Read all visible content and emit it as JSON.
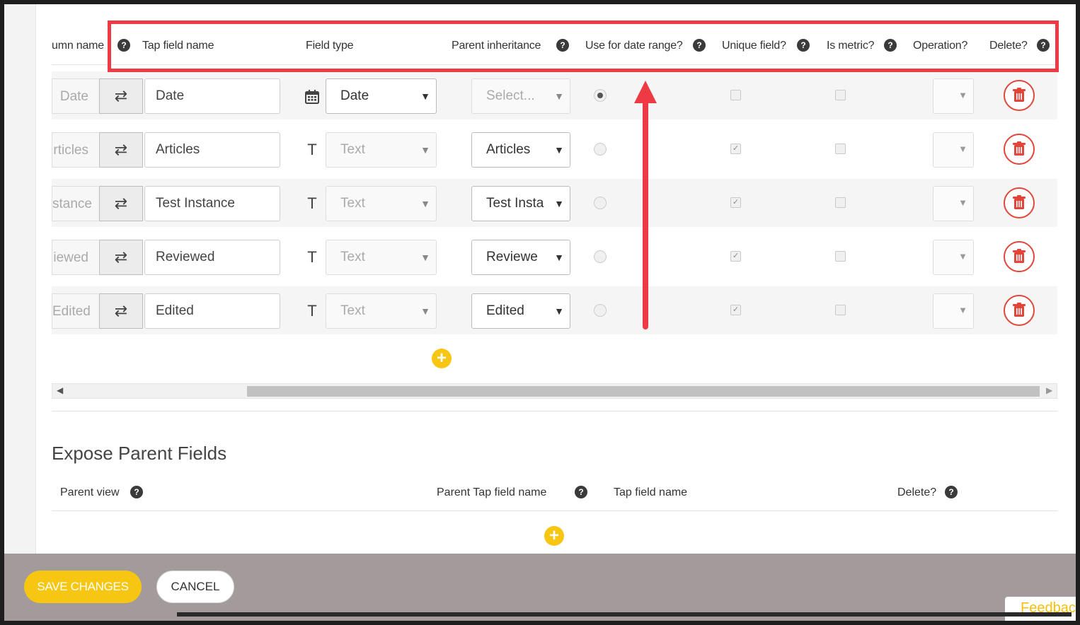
{
  "field_table": {
    "headers": {
      "column_name": "umn name",
      "tap_field_name": "Tap field name",
      "field_type": "Field type",
      "parent_inheritance": "Parent inheritance",
      "use_for_date_range": "Use for date range?",
      "unique_field": "Unique field?",
      "is_metric": "Is metric?",
      "operation": "Operation?",
      "delete": "Delete?"
    },
    "help_glyph": "?",
    "swap_glyph": "⇄",
    "arrow_glyph": "▼",
    "rows": [
      {
        "column_name": "Date",
        "tap_field_name": "Date",
        "type_icon": "calendar-icon",
        "type_glyph": "",
        "field_type": "Date",
        "parent_inheritance": "Select...",
        "date_range": true,
        "unique": false,
        "metric": false
      },
      {
        "column_name": "rticles",
        "tap_field_name": "Articles",
        "type_icon": "text-icon",
        "type_glyph": "T",
        "field_type": "Text",
        "parent_inheritance": "Articles",
        "date_range": false,
        "unique": true,
        "metric": false
      },
      {
        "column_name": "stance",
        "tap_field_name": "Test Instance",
        "type_icon": "text-icon",
        "type_glyph": "T",
        "field_type": "Text",
        "parent_inheritance": "Test Insta",
        "date_range": false,
        "unique": true,
        "metric": false
      },
      {
        "column_name": "iewed",
        "tap_field_name": "Reviewed",
        "type_icon": "text-icon",
        "type_glyph": "T",
        "field_type": "Text",
        "parent_inheritance": "Reviewe",
        "date_range": false,
        "unique": true,
        "metric": false
      },
      {
        "column_name": "Edited",
        "tap_field_name": "Edited",
        "type_icon": "text-icon",
        "type_glyph": "T",
        "field_type": "Text",
        "parent_inheritance": "Edited",
        "date_range": false,
        "unique": true,
        "metric": false
      }
    ],
    "add_glyph": "+"
  },
  "expose_parent": {
    "title": "Expose Parent Fields",
    "headers": {
      "parent_view": "Parent view",
      "parent_tap_field_name": "Parent Tap field name",
      "tap_field_name": "Tap field name",
      "delete": "Delete?"
    },
    "add_glyph": "+"
  },
  "footer": {
    "save_label": "SAVE CHANGES",
    "cancel_label": "CANCEL",
    "feedback_label": "Feedback"
  },
  "colors": {
    "accent_yellow": "#f7c613",
    "delete_red": "#e0463a",
    "annotation_red": "#ee3a45",
    "footer_gray": "#a39a9b"
  }
}
